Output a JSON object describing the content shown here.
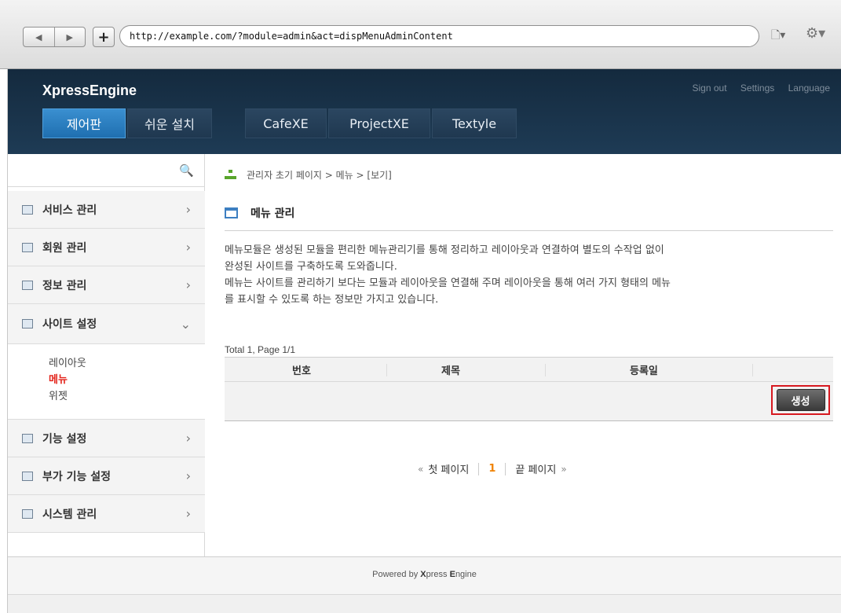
{
  "browser": {
    "url": "http://example.com/?module=admin&act=dispMenuAdminContent",
    "back_icon": "◀",
    "forward_icon": "▶",
    "new_tab_icon": "+",
    "page_menu_icon": "🗋▾",
    "settings_menu_icon": "⚙▾"
  },
  "header": {
    "brand": "XpressEngine",
    "links": [
      "Sign out",
      "Settings",
      "Language"
    ],
    "tabs": [
      "제어판",
      "쉬운 설치",
      "CafeXE",
      "ProjectXE",
      "Textyle"
    ],
    "active_tab": "제어판",
    "accent_color": "#2a7fc4"
  },
  "sidebar": {
    "search_placeholder": "",
    "search_icon": "🔍",
    "items": [
      {
        "label": "서비스 관리",
        "chevron": "›"
      },
      {
        "label": "회원 관리",
        "chevron": "›"
      },
      {
        "label": "정보 관리",
        "chevron": "›"
      },
      {
        "label": "사이트 설정",
        "chevron": "⌄"
      },
      {
        "label": "기능 설정",
        "chevron": "›"
      },
      {
        "label": "부가 기능 설정",
        "chevron": "›"
      },
      {
        "label": "시스템 관리",
        "chevron": "›"
      }
    ],
    "sub_items": [
      {
        "label": "레이아웃",
        "active": false
      },
      {
        "label": "메뉴",
        "active": true
      },
      {
        "label": "위젯",
        "active": false
      }
    ],
    "active_sub_color": "#e3241b"
  },
  "content": {
    "breadcrumb": "관리자 초기 페이지 > 메뉴 > [보기]",
    "title": "메뉴 관리",
    "description": [
      "메뉴모듈은 생성된 모듈을 편리한 메뉴관리기를 통해 정리하고 레이아웃과 연결하여 별도의 수작업 없이",
      "완성된 사이트를 구축하도록 도와줍니다.",
      "메뉴는 사이트를 관리하기 보다는 모듈과 레이아웃을 연결해 주며 레이아웃을 통해 여러 가지 형태의 메뉴",
      "를 표시할 수 있도록 하는 정보만 가지고 있습니다."
    ],
    "total": "Total 1, Page 1/1",
    "table_headers": [
      "번호",
      "제목",
      "등록일"
    ],
    "create_button": "생성",
    "pagination": {
      "first_arrow": "«",
      "first": "첫 페이지",
      "current": "1",
      "last": "끝 페이지",
      "last_arrow": "»"
    }
  },
  "footer": {
    "prefix": "Powered by ",
    "name_x": "X",
    "name_press": "press ",
    "name_e": "E",
    "name_ngine": "ngine"
  }
}
